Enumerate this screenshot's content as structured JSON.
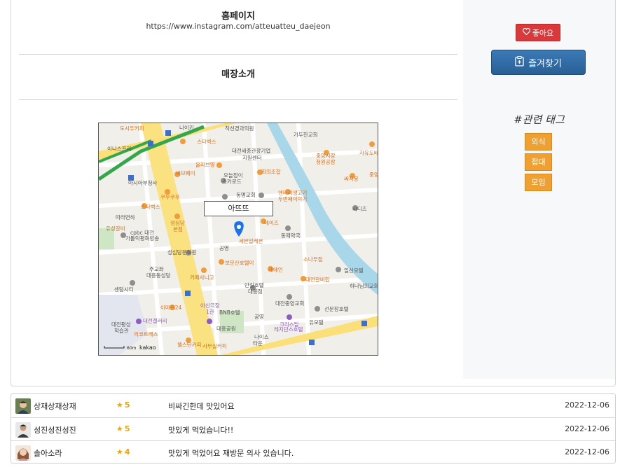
{
  "homepage": {
    "title": "홈페이지",
    "url": "https://www.instagram.com/atteuatteu_daejeon"
  },
  "intro": {
    "title": "매장소개"
  },
  "map": {
    "marker_label": "아뜨뜨",
    "scale_label": "60m",
    "brand": "kakao",
    "labels": [
      "도시우커피",
      "나이키",
      "착선경과의원",
      "가두한교회",
      "스타벅스",
      "대전세종관광기업 지원센터",
      "올리브영",
      "회의조합",
      "중앙시장 청원공장",
      "이니스프리",
      "아시아부청사",
      "써브웨이",
      "스타벅스",
      "커피나무",
      "쿠우쿠우",
      "오늘정이 스카로드",
      "동명교회",
      "엔터리생고기 두번째이야기",
      "파스쿠찌",
      "따라면하",
      "유성갈비",
      "cpbc 대전 가톨릭평화방송",
      "성심당 본점",
      "데이즈",
      "동제약국",
      "세븐일레븐",
      "공영",
      "성심당문화원",
      "보문산호텔이",
      "소나무집",
      "트레이",
      "일선모텔",
      "주교좌 대흥동성당",
      "카페사니고",
      "만길호텔 대흥점",
      "대전갈비집",
      "하나님의교회",
      "센텀시티",
      "대전중앙교회",
      "선문장호텔",
      "이마트24",
      "아신극장 1관",
      "BNB호텔",
      "대전갤러리",
      "공영",
      "크리스탈 레지던스호텔",
      "유모텔",
      "대전평성 학습관",
      "리코트레스",
      "대흥공원",
      "웰스탄커피",
      "사무실커피",
      "나이스 타운",
      "시디즈",
      "싸지봉",
      "자유도배",
      "중앙"
    ]
  },
  "actions": {
    "like_label": "좋아요",
    "favorite_label": "즐겨찾기"
  },
  "tags": {
    "title": "#관련 태그",
    "items": [
      "외식",
      "접대",
      "모임"
    ]
  },
  "reviews": [
    {
      "name": "상재상재상재",
      "rating": "5",
      "text": "비싸긴한데 맛있어요",
      "date": "2022-12-06"
    },
    {
      "name": "성진성진성진",
      "rating": "5",
      "text": "맛있게 먹었습니다!!",
      "date": "2022-12-06"
    },
    {
      "name": "솔아소라",
      "rating": "4",
      "text": "맛있게 먹었어요 재방문 의사 있습니다.",
      "date": "2022-12-06"
    }
  ],
  "colors": {
    "like": "#d9393a",
    "favorite": "#2f6ba5",
    "tag": "#f0a030",
    "star": "#f0a500",
    "road_major": "#fbe07a",
    "river": "#a9d7ea",
    "subway": "#33a84a",
    "marker": "#1a73e8"
  }
}
